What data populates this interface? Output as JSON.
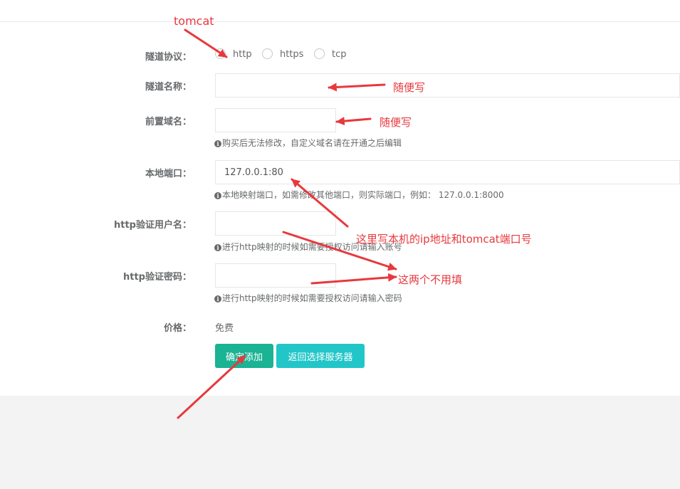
{
  "form": {
    "protocol": {
      "label": "隧道协议：",
      "options": [
        "http",
        "https",
        "tcp"
      ]
    },
    "tunnel_name": {
      "label": "隧道名称：",
      "value": ""
    },
    "prefix_domain": {
      "label": "前置域名：",
      "value": "",
      "help": "购买后无法修改，自定义域名请在开通之后编辑"
    },
    "local_port": {
      "label": "本地端口：",
      "value": "127.0.0.1:80",
      "help": "本地映射端口，如需修改其他端口，则实际端口，例如： 127.0.0.1:8000"
    },
    "http_user": {
      "label": "http验证用户名：",
      "value": "",
      "help": "进行http映射的时候如需要授权访问请输入账号"
    },
    "http_password": {
      "label": "http验证密码：",
      "value": "",
      "help": "进行http映射的时候如需要授权访问请输入密码"
    },
    "price": {
      "label": "价格：",
      "value": "免费"
    },
    "buttons": {
      "confirm": "确定添加",
      "back": "返回选择服务器"
    }
  },
  "annotations": {
    "tomcat": "tomcat",
    "name_hint": "随便写",
    "domain_hint": "随便写",
    "port_hint": "这里写本机的ip地址和tomcat端口号",
    "auth_hint": "这两个不用填"
  },
  "colors": {
    "primary": "#1ab394",
    "info": "#23c6c8",
    "annotation": "#e8383d",
    "background": "#f3f3f3"
  }
}
